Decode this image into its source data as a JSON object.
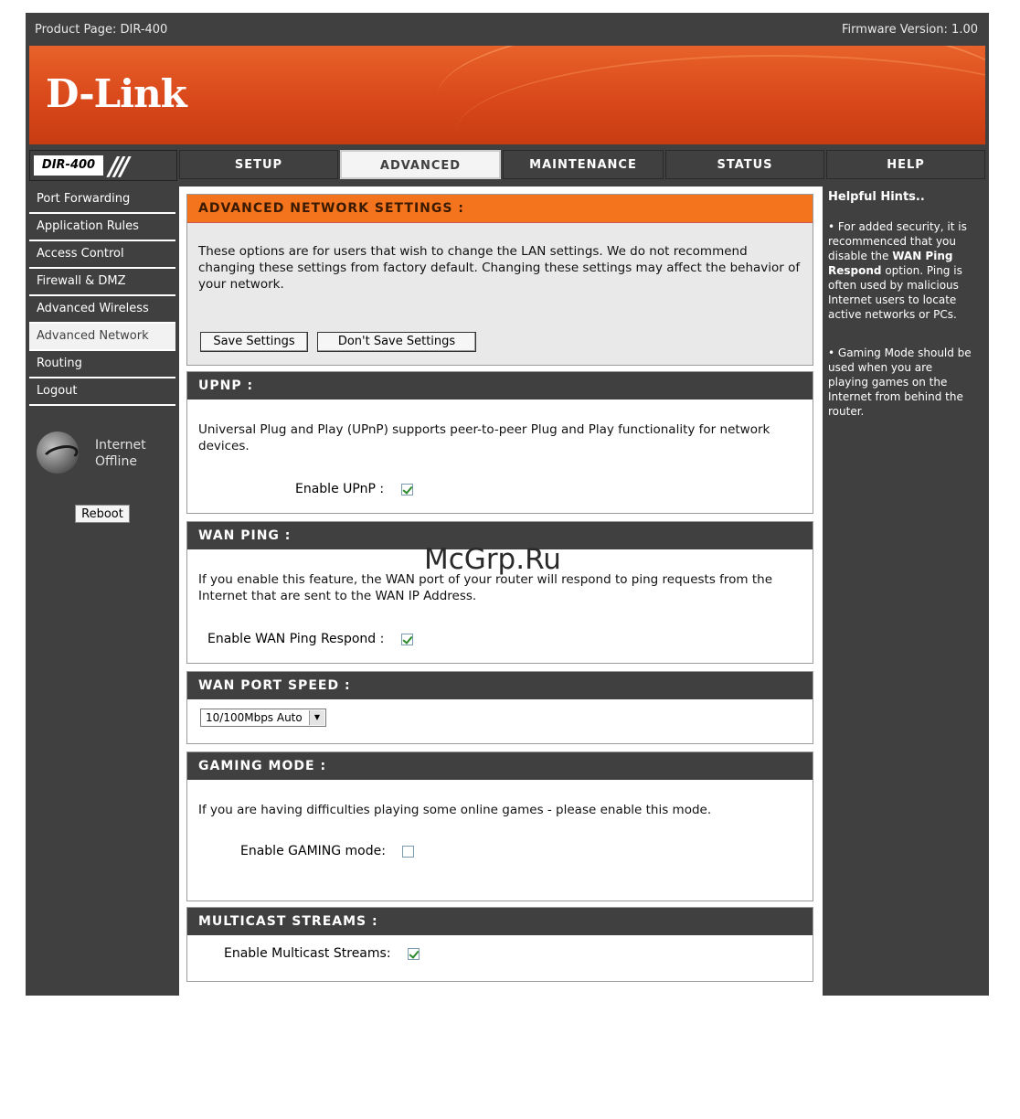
{
  "topbar": {
    "product": "Product Page: DIR-400",
    "firmware": "Firmware Version: 1.00"
  },
  "brand": {
    "logo": "D-Link",
    "model": "DIR-400"
  },
  "tabs": [
    "SETUP",
    "ADVANCED",
    "MAINTENANCE",
    "STATUS",
    "HELP"
  ],
  "sidebar": {
    "items": [
      "Port Forwarding",
      "Application Rules",
      "Access Control",
      "Firewall & DMZ",
      "Advanced Wireless",
      "Advanced Network",
      "Routing",
      "Logout"
    ],
    "status_line1": "Internet",
    "status_line2": "Offline",
    "reboot": "Reboot"
  },
  "main": {
    "adv_title": "ADVANCED NETWORK SETTINGS :",
    "adv_text": "These options are for users that wish to change the LAN settings. We do not recommend changing these settings from factory default. Changing these settings may affect the behavior of your network.",
    "save": "Save Settings",
    "dont_save": "Don't Save Settings",
    "upnp_title": "UPNP :",
    "upnp_text": "Universal Plug and Play (UPnP) supports peer-to-peer Plug and Play functionality for network devices.",
    "upnp_label": "Enable UPnP :",
    "wanping_title": "WAN PING :",
    "wanping_text": "If you enable this feature, the WAN port of your router will respond to ping requests from the Internet that are sent to the WAN IP Address.",
    "wanping_label": "Enable WAN Ping Respond :",
    "wanspeed_title": "WAN PORT SPEED :",
    "wanspeed_value": "10/100Mbps Auto",
    "gaming_title": "GAMING MODE :",
    "gaming_text": "If you are having difficulties playing some online games - please enable this mode.",
    "gaming_label": "Enable GAMING mode:",
    "multicast_title": "MULTICAST STREAMS :",
    "multicast_label": "Enable Multicast Streams:"
  },
  "checkbox_states": {
    "upnp": true,
    "wan_ping": true,
    "gaming": false,
    "multicast": true
  },
  "help": {
    "title": "Helpful Hints..",
    "hint1_pre": "• For added security, it is recommenced that you disable the ",
    "hint1_bold": "WAN Ping Respond",
    "hint1_post": " option. Ping is often used by malicious Internet users to locate active networks or PCs.",
    "hint2": "• Gaming Mode should be used when you are playing games on the Internet from behind the router."
  },
  "watermark": "McGrp.Ru"
}
